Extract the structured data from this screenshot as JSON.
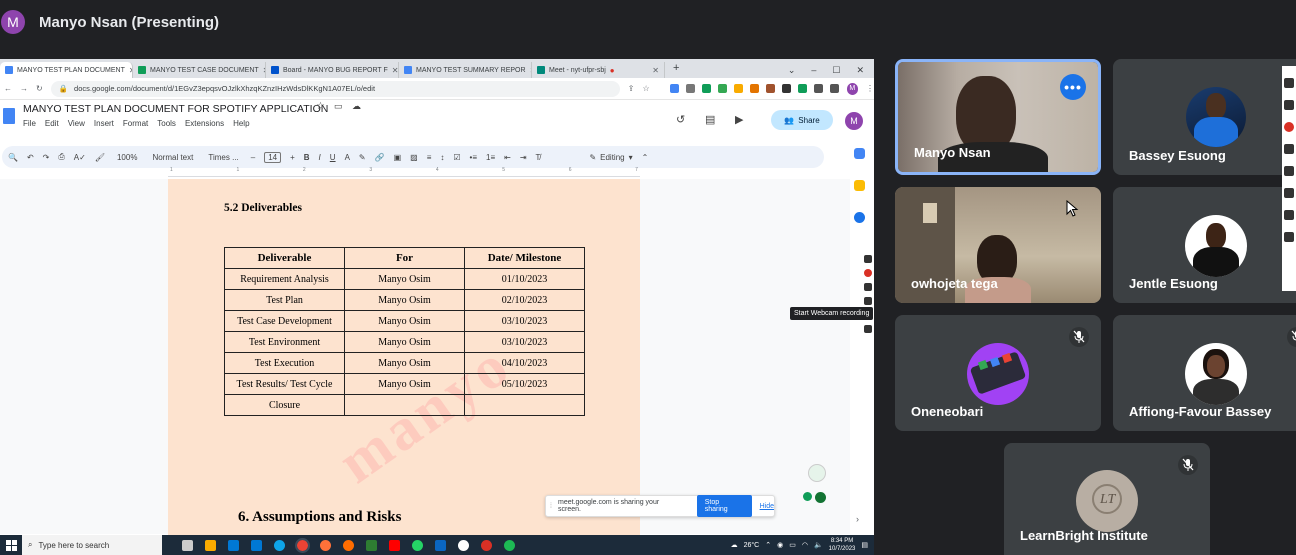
{
  "meeting": {
    "presenter_initial": "M",
    "presenter_title": "Manyo Nsan (Presenting)"
  },
  "browser": {
    "tabs": [
      {
        "label": "MANYO TEST PLAN DOCUMENT",
        "color": "#4285f4",
        "active": true
      },
      {
        "label": "MANYO TEST CASE DOCUMENT",
        "color": "#0f9d58",
        "active": false
      },
      {
        "label": "Board - MANYO BUG REPORT F",
        "color": "#0052cc",
        "active": false
      },
      {
        "label": "MANYO TEST SUMMARY REPOR",
        "color": "#4285f4",
        "active": false
      },
      {
        "label": "Meet - nyt-ufpr-sbj",
        "color": "#00897b",
        "active": false
      }
    ],
    "new_tab": "+",
    "url": "docs.google.com/document/d/1EGvZ3epqsvOJzlkXhzqKZnzIHzWdsDlKKgN1A07EL/o/edit",
    "account_initial": "M"
  },
  "docs": {
    "title": "MANYO TEST PLAN DOCUMENT FOR SPOTIFY APPLICATION",
    "menu": [
      "File",
      "Edit",
      "View",
      "Insert",
      "Format",
      "Tools",
      "Extensions",
      "Help"
    ],
    "share_label": "Share",
    "zoom": "100%",
    "style": "Normal text",
    "font": "Times ...",
    "font_size": "14",
    "mode": "Editing"
  },
  "document": {
    "section_heading": "5.2 Deliverables",
    "table_headers": [
      "Deliverable",
      "For",
      "Date/ Milestone"
    ],
    "table_rows": [
      [
        "Requirement Analysis",
        "Manyo Osim",
        "01/10/2023"
      ],
      [
        "Test Plan",
        "Manyo Osim",
        "02/10/2023"
      ],
      [
        "Test Case Development",
        "Manyo Osim",
        "03/10/2023"
      ],
      [
        "Test Environment",
        "Manyo Osim",
        "03/10/2023"
      ],
      [
        "Test Execution",
        "Manyo Osim",
        "04/10/2023"
      ],
      [
        "Test Results/ Test Cycle",
        "Manyo Osim",
        "05/10/2023"
      ],
      [
        "Closure",
        "",
        ""
      ]
    ],
    "watermark": "manyo",
    "next_heading": "6.  Assumptions and Risks"
  },
  "overlays": {
    "tooltip": "Start Webcam recording",
    "share_notice": "meet.google.com is sharing your screen.",
    "stop_sharing": "Stop sharing",
    "hide": "Hide"
  },
  "taskbar": {
    "search_placeholder": "Type here to search",
    "weather": "26°C",
    "time": "8:34 PM",
    "date": "10/7/2023"
  },
  "participants": [
    {
      "name": "Manyo Nsan",
      "video": true,
      "muted": false
    },
    {
      "name": "Bassey Esuong",
      "video": false,
      "muted": false
    },
    {
      "name": "owhojeta tega",
      "video": true,
      "muted": true
    },
    {
      "name": "Jentle Esuong",
      "video": false,
      "muted": false
    },
    {
      "name": "Oneneobari",
      "video": false,
      "muted": true
    },
    {
      "name": "Affiong-Favour Bassey",
      "video": false,
      "muted": true
    },
    {
      "name": "LearnBright Institute",
      "video": false,
      "muted": true
    }
  ]
}
